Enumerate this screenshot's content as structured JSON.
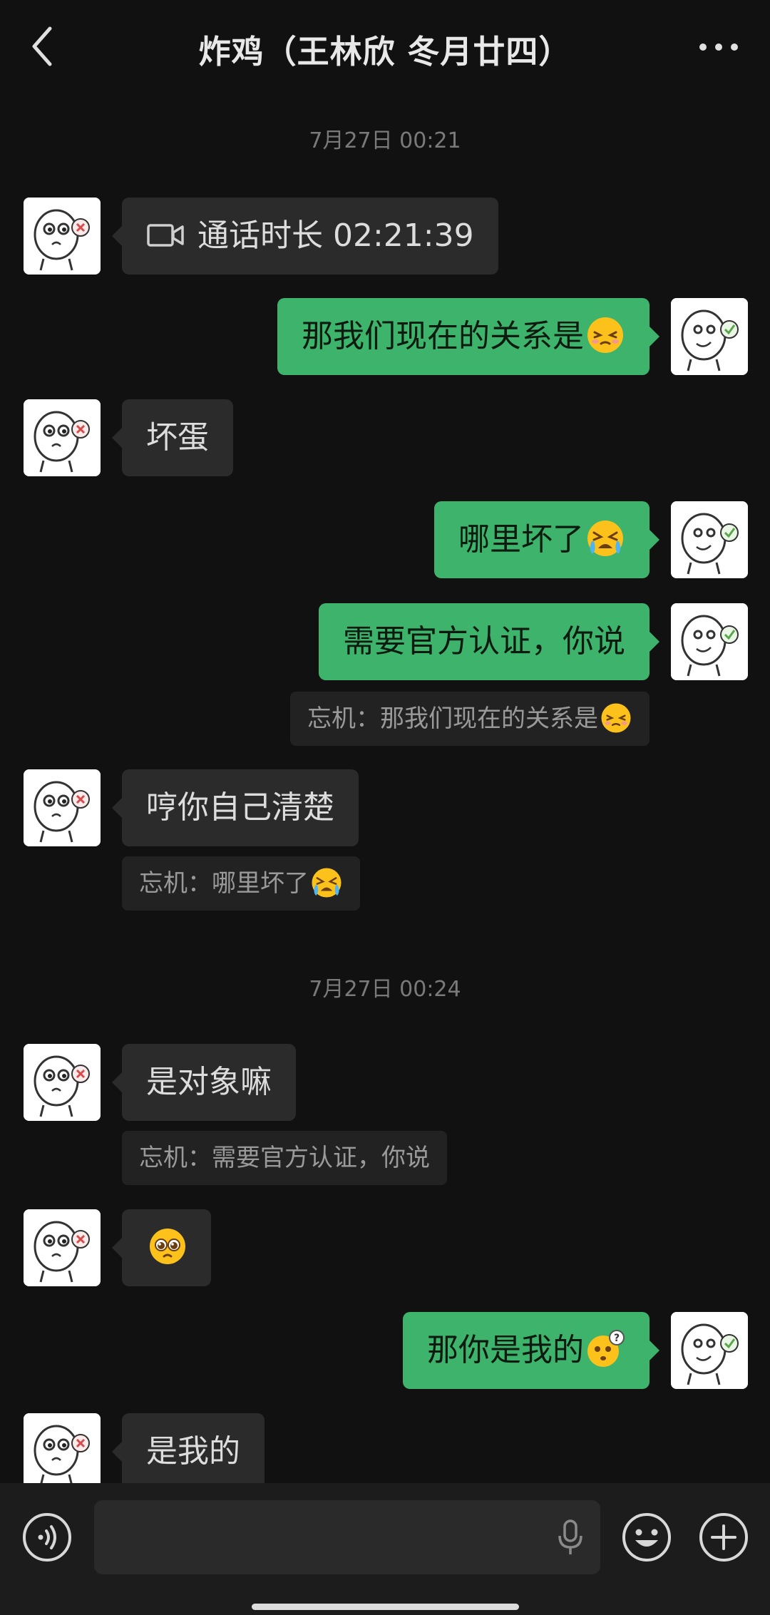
{
  "header": {
    "title": "炸鸡（王林欣 冬月廿四）"
  },
  "messages": {
    "time1": "7月27日 00:21",
    "call_label": "通话时长 02:21:39",
    "m1": "那我们现在的关系是",
    "m2": "坏蛋",
    "m3": "哪里坏了",
    "m4": "需要官方认证，你说",
    "q1": "忘机：那我们现在的关系是",
    "m5": "哼你自己清楚",
    "q2": "忘机：哪里坏了",
    "time2": "7月27日 00:24",
    "m6": "是对象嘛",
    "q3": "忘机：需要官方认证，你说",
    "m8": "那你是我的",
    "m9": "是我的"
  },
  "colors": {
    "outgoing_bubble": "#3db36b",
    "incoming_bubble": "#2b2b2b",
    "background": "#111111"
  },
  "icons": [
    "back-arrow-icon",
    "more-icon",
    "video-call-icon",
    "sleepy-emoji-icon",
    "crying-emoji-icon",
    "pleading-emoji-icon",
    "thinking-emoji-icon",
    "voice-icon",
    "mic-icon",
    "smiley-icon",
    "plus-icon"
  ]
}
